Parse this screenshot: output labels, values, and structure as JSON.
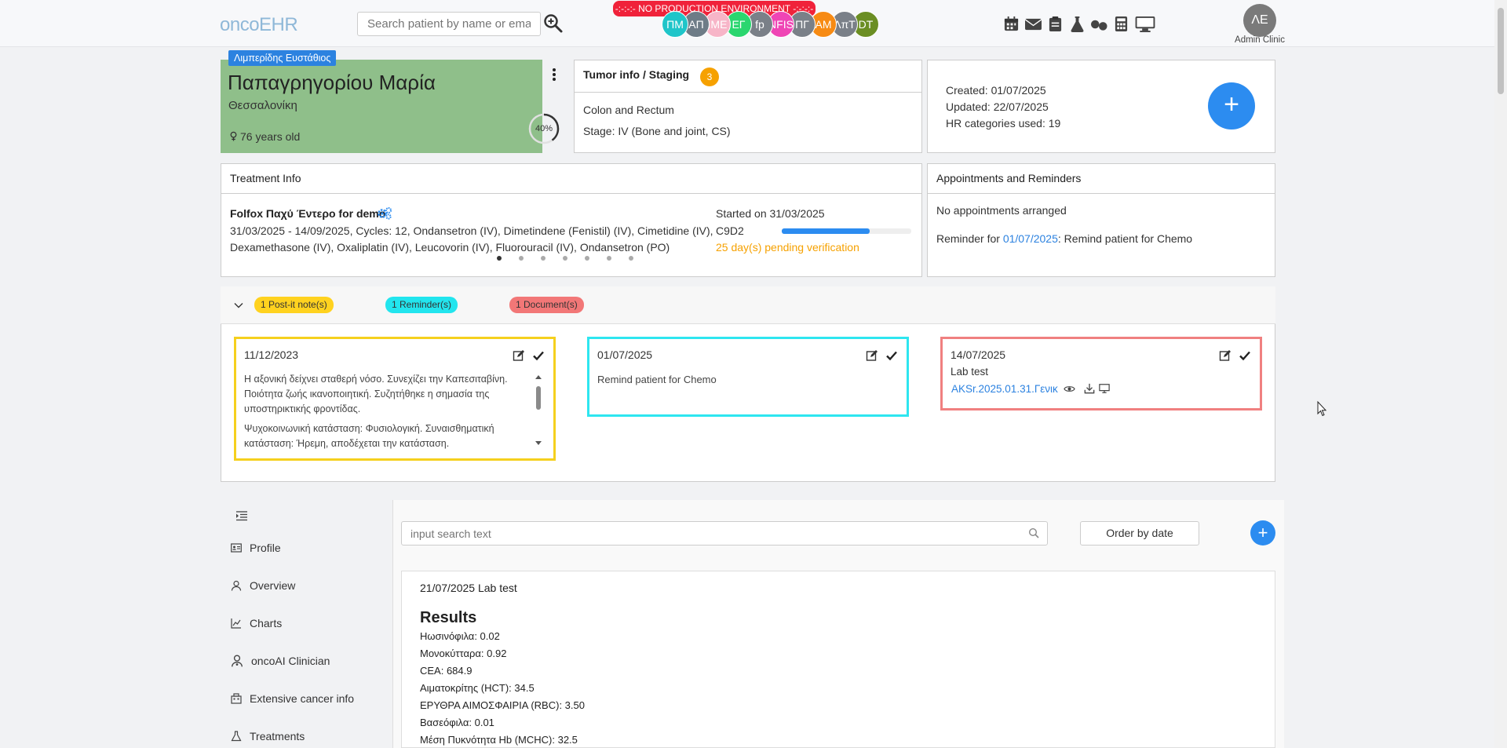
{
  "header": {
    "logo": "oncoEHR",
    "search_placeholder": "Search patient by name or email",
    "env_banner": "-:-:-:- NO PRODUCTION ENVIRONMENT -:-:-:-",
    "open_patients": [
      {
        "initials": "ΠΜ",
        "color": "#1fc5c9"
      },
      {
        "initials": "ΑΠ",
        "color": "#6e7c87"
      },
      {
        "initials": "ΙΜΕ",
        "color": "#f7b5c8"
      },
      {
        "initials": "ΕΓ",
        "color": "#2ad66f"
      },
      {
        "initials": "fp",
        "color": "#7a8088"
      },
      {
        "initials": "NFIS",
        "color": "#ef45b5"
      },
      {
        "initials": "ΠΓ",
        "color": "#7a8088"
      },
      {
        "initials": "AM",
        "color": "#f78b14"
      },
      {
        "initials": "ΛπΤ",
        "color": "#7a8088"
      },
      {
        "initials": "DT",
        "color": "#6b8e23"
      }
    ],
    "toolbar_icons": [
      "calendar-icon",
      "mail-icon",
      "clipboard-icon",
      "flask-icon",
      "pills-icon",
      "calculator-icon",
      "monitor-icon"
    ],
    "user_initials": "ΛΕ",
    "user_label": "Admin Clinic"
  },
  "patient": {
    "doctor_badge": "Λιμπερίδης Ευστάθιος",
    "name": "Παπαγρηγορίου Μαρία",
    "city": "Θεσσαλονίκη",
    "age": "76 years old",
    "completeness": "40%",
    "completeness_value": 0.4
  },
  "tumor": {
    "title": "Tumor info / Staging",
    "count": "3",
    "site": "Colon and Rectum",
    "stage": "Stage: IV (Bone and joint, CS)"
  },
  "record": {
    "created": "Created: 01/07/2025",
    "updated": "Updated: 22/07/2025",
    "hr_categories": "HR categories used: 19"
  },
  "treatment": {
    "title": "Treatment Info",
    "name": "Folfox Παχύ Έντερο for demo",
    "line1": "31/03/2025 - 14/09/2025, Cycles: 12, Ondansetron (IV), Dimetindene (Fenistil) (IV), Cimetidine (IV),",
    "line2": "Dexamethasone (IV), Oxaliplatin (IV), Leucovorin (IV), Fluorouracil (IV), Ondansetron (PO)",
    "started": "Started on 31/03/2025",
    "cycle": "C9D2",
    "progress_fraction": 0.68,
    "pending": "25 day(s) pending verification",
    "carousel_pages": 7,
    "carousel_active": 0
  },
  "appointments": {
    "title": "Appointments and Reminders",
    "none_text": "No appointments arranged",
    "reminder_prefix": "Reminder for ",
    "reminder_date": "01/07/2025",
    "reminder_suffix": ": Remind patient for Chemo"
  },
  "notes": {
    "tags": {
      "postit": "1 Post-it note(s)",
      "reminder": "1 Reminder(s)",
      "document": "1 Document(s)"
    },
    "postit": {
      "date": "11/12/2023",
      "para1": "Η αξονική δείχνει σταθερή νόσο. Συνεχίζει την Καπεσιταβίνη. Ποιότητα ζωής ικανοποιητική. Συζητήθηκε η σημασία της υποστηρικτικής φροντίδας.",
      "para2": "Ψυχοκοινωνική κατάσταση: Φυσιολογική. Συναισθηματική κατάσταση: Ήρεμη, αποδέχεται την κατάσταση."
    },
    "reminder": {
      "date": "01/07/2025",
      "text": "Remind patient for Chemo"
    },
    "document": {
      "date": "14/07/2025",
      "title": "Lab test",
      "file": "AKSr.2025.01.31.Γενικ"
    }
  },
  "sidebar": {
    "items": [
      {
        "label": "Profile",
        "icon": "id-card-icon"
      },
      {
        "label": "Overview",
        "icon": "user-icon"
      },
      {
        "label": "Charts",
        "icon": "chart-icon"
      },
      {
        "label": "oncoAI Clinician",
        "icon": "doctor-icon"
      },
      {
        "label": "Extensive cancer info",
        "icon": "building-icon"
      },
      {
        "label": "Treatments",
        "icon": "flask-icon"
      }
    ]
  },
  "content": {
    "search_placeholder": "input search text",
    "order_label": "Order by date",
    "result_title": "21/07/2025 Lab test",
    "results_heading": "Results",
    "results": [
      "Ηωσινόφιλα: 0.02",
      "Μονοκύτταρα: 0.92",
      "CEA: 684.9",
      "Αιματοκρίτης (HCT): 34.5",
      "ΕΡΥΘΡΑ ΑΙΜΟΣΦΑΙΡΙΑ (RBC): 3.50",
      "Βασεόφιλα: 0.01",
      "Μέση Πυκνότητα Hb (MCHC): 32.5"
    ]
  },
  "colors": {
    "accent": "#2c8cf0",
    "patient_card": "#8fbf8a",
    "warning": "#f6a100",
    "banner": "#f0223a",
    "postit": "#f5d01e",
    "reminder": "#2ee6f0",
    "document": "#f08080"
  }
}
